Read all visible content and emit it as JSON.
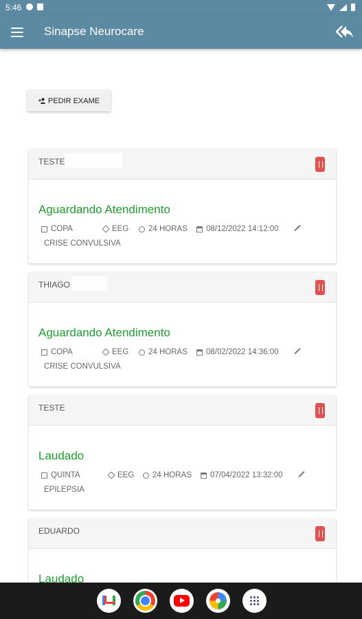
{
  "status_bar": {
    "time": "5:46",
    "left_icons": [
      "message-icon",
      "notification-icon"
    ],
    "right_icons": [
      "wifi-icon",
      "signal-icon",
      "battery-icon"
    ]
  },
  "app_bar": {
    "title": "Sinapse Neurocare",
    "menu_icon": "menu-icon",
    "action_icon": "reply-all-icon"
  },
  "actions": {
    "pedir_exame_label": "PEDIR EXAME"
  },
  "colors": {
    "primary": "#5b8aa2",
    "status_green": "#1e9e2e",
    "delete_red": "#e05252"
  },
  "cards": [
    {
      "patient": "TESTE",
      "status": "Aguardando Atendimento",
      "location": "COPA",
      "exam": "EEG",
      "duration": "24 HORAS",
      "datetime": "08/12/2022 14:12:00",
      "diagnosis": "CRISE CONVULSIVA"
    },
    {
      "patient": "THIAGO",
      "status": "Aguardando Atendimento",
      "location": "COPA",
      "exam": "EEG",
      "duration": "24 HORAS",
      "datetime": "08/02/2022 14:36:00",
      "diagnosis": "CRISE CONVULSIVA"
    },
    {
      "patient": "TESTE",
      "status": "Laudado",
      "location": "QUINTA",
      "exam": "EEG",
      "duration": "24 HORAS",
      "datetime": "07/04/2022 13:32:00",
      "diagnosis": "EPILEPSIA"
    },
    {
      "patient": "EDUARDO",
      "status": "Laudado"
    }
  ],
  "dock": [
    "gmail-icon",
    "chrome-icon",
    "youtube-icon",
    "photos-icon",
    "app-drawer-icon"
  ]
}
